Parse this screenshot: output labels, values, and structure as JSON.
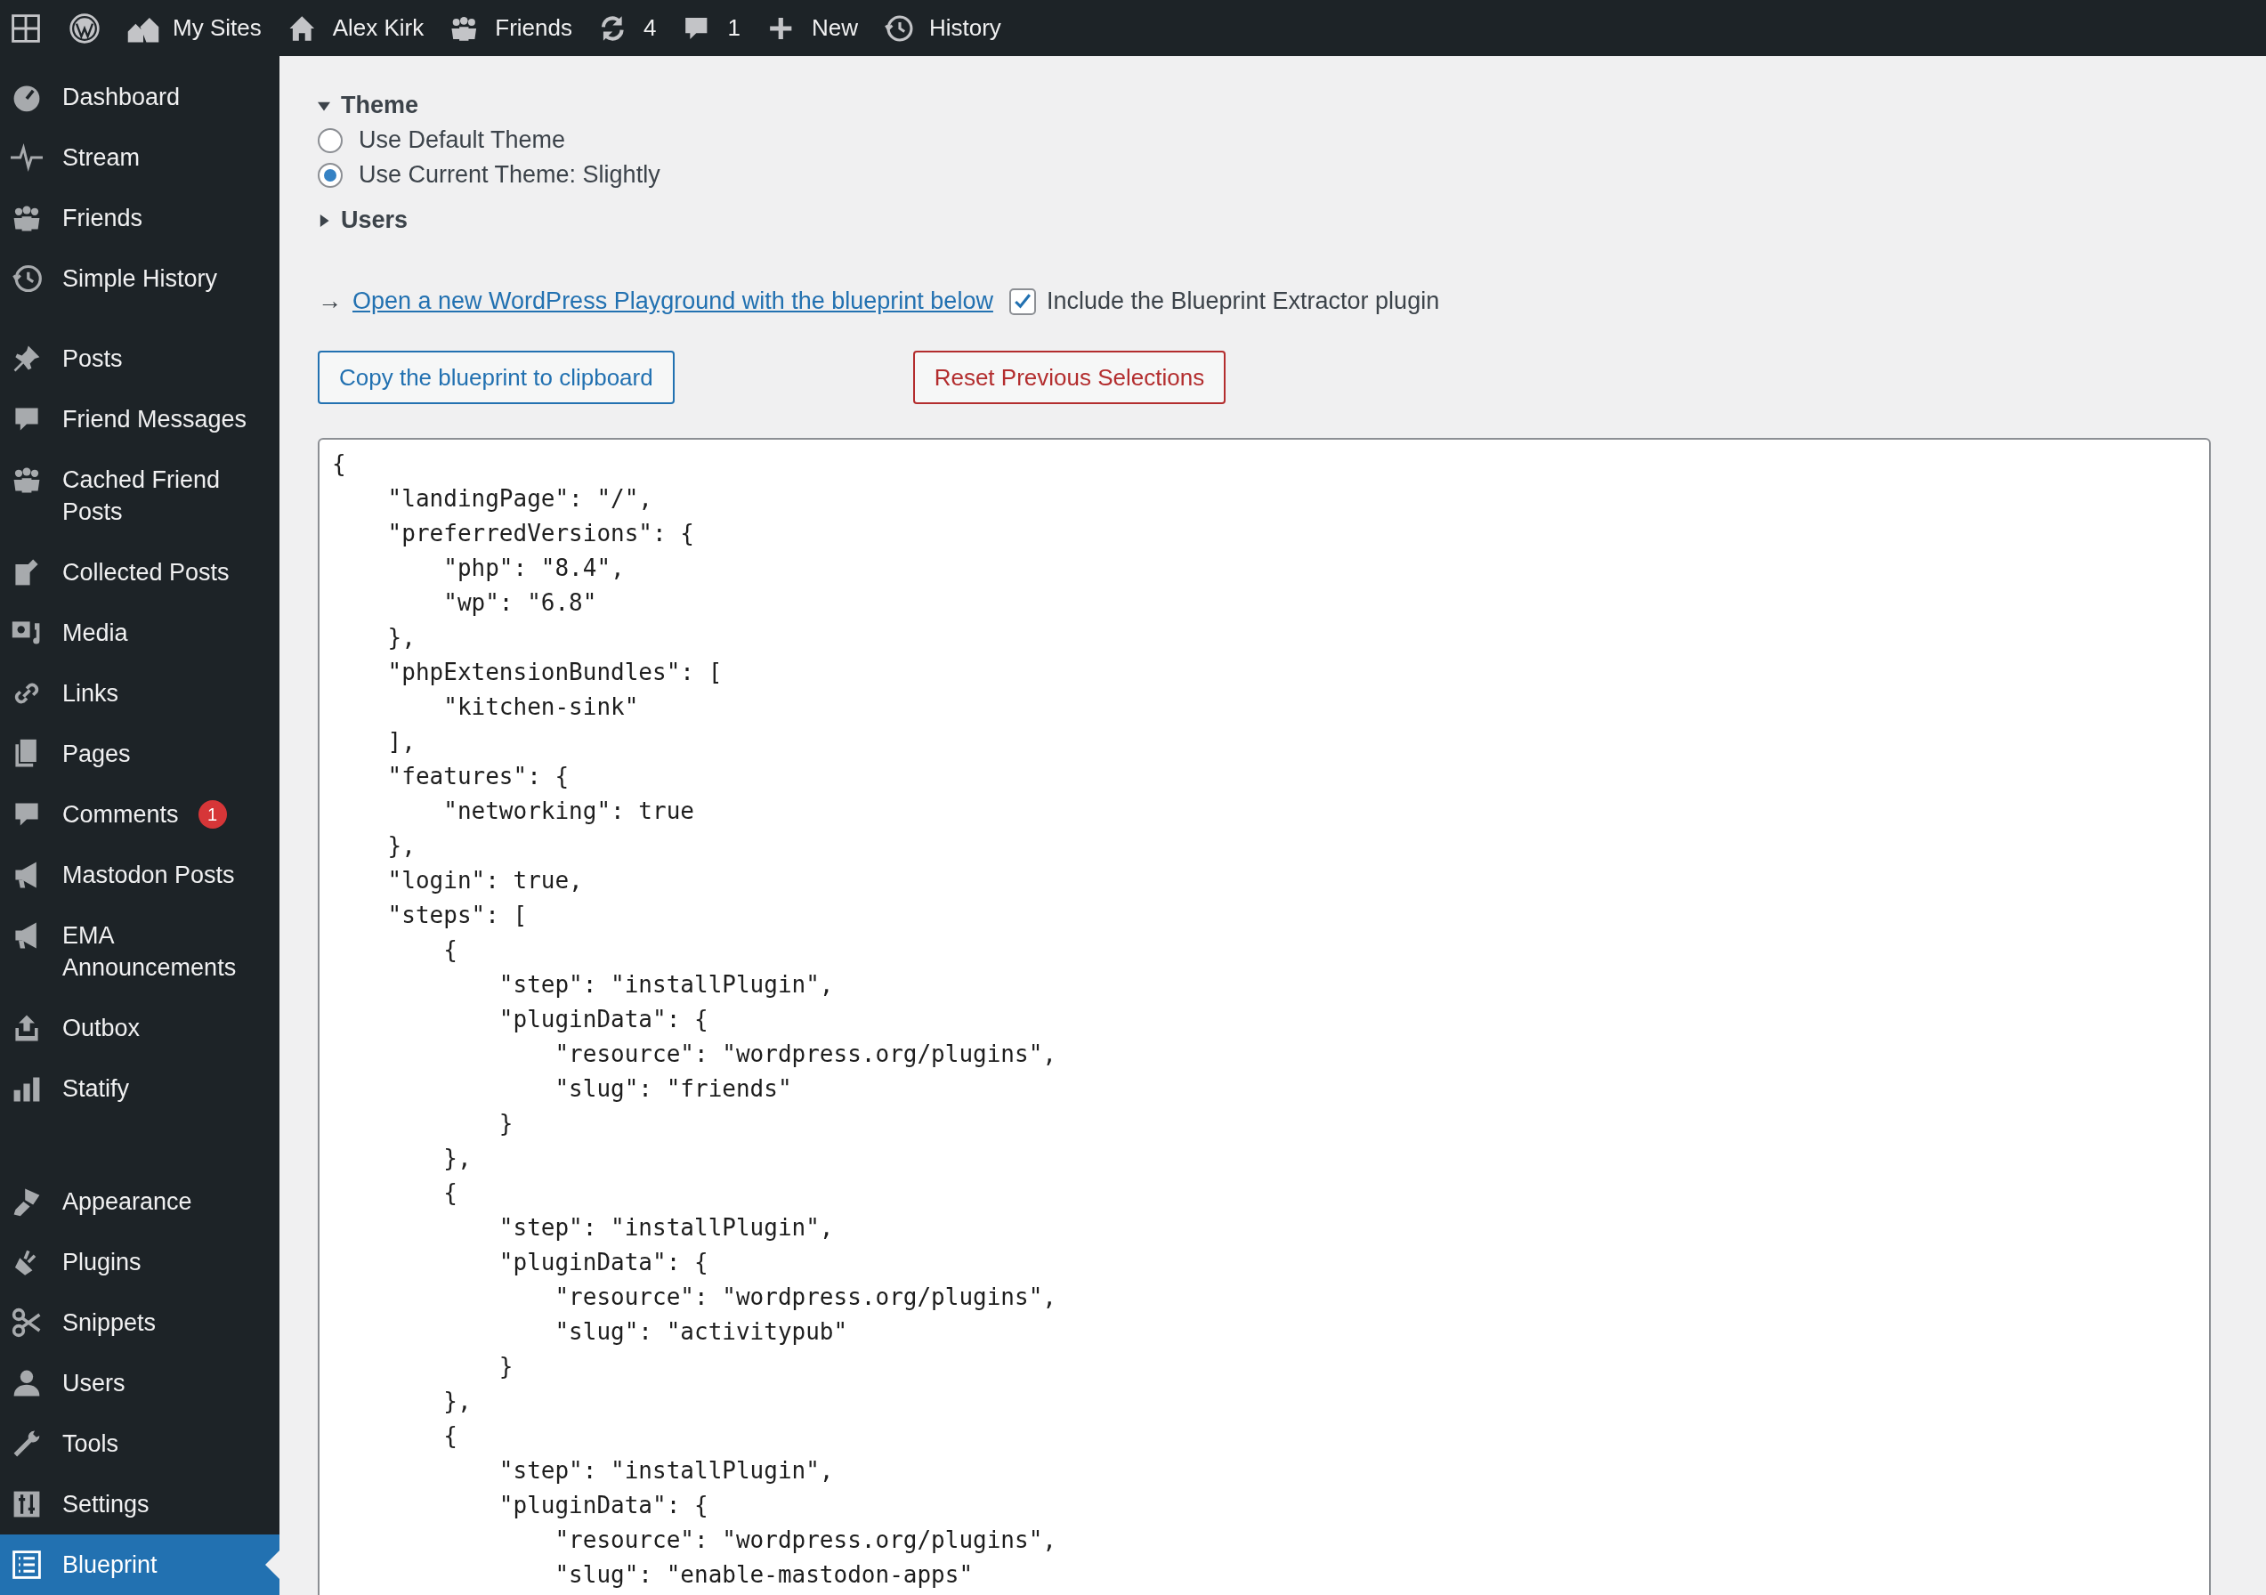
{
  "admin_bar": {
    "items": [
      {
        "label": "My Sites"
      },
      {
        "label": "Alex Kirk"
      },
      {
        "label": "Friends"
      },
      {
        "label": "4"
      },
      {
        "label": "1"
      },
      {
        "label": "New"
      },
      {
        "label": "History"
      }
    ]
  },
  "sidebar": {
    "groups": [
      {
        "items": [
          {
            "label": "Dashboard",
            "selected": false
          },
          {
            "label": "Stream",
            "selected": false
          },
          {
            "label": "Friends",
            "selected": false
          },
          {
            "label": "Simple History",
            "selected": false
          }
        ]
      },
      {
        "items": [
          {
            "label": "Posts",
            "selected": false
          },
          {
            "label": "Friend Messages",
            "selected": false
          },
          {
            "label": "Cached Friend Posts",
            "selected": false
          },
          {
            "label": "Collected Posts",
            "selected": false
          },
          {
            "label": "Media",
            "selected": false
          },
          {
            "label": "Links",
            "selected": false
          },
          {
            "label": "Pages",
            "selected": false
          },
          {
            "label": "Comments",
            "selected": false,
            "badge": "1"
          },
          {
            "label": "Mastodon Posts",
            "selected": false
          },
          {
            "label": "EMA Announcements",
            "selected": false
          },
          {
            "label": "Outbox",
            "selected": false
          },
          {
            "label": "Statify",
            "selected": false
          }
        ]
      },
      {
        "items": [
          {
            "label": "Appearance",
            "selected": false
          },
          {
            "label": "Plugins",
            "selected": false
          },
          {
            "label": "Snippets",
            "selected": false
          },
          {
            "label": "Users",
            "selected": false
          },
          {
            "label": "Tools",
            "selected": false
          },
          {
            "label": "Settings",
            "selected": false
          },
          {
            "label": "Blueprint",
            "selected": true
          }
        ]
      }
    ]
  },
  "sections": [
    {
      "title": "Theme",
      "expanded": true,
      "options": [
        {
          "label": "Use Default Theme",
          "selected": false
        },
        {
          "label": "Use Current Theme: Slightly",
          "selected": true
        }
      ]
    },
    {
      "title": "Users",
      "expanded": false
    }
  ],
  "playground_link": {
    "arrow": "→",
    "text": "Open a new WordPress Playground with the blueprint below",
    "checkbox": {
      "label": "Include the Blueprint Extractor plugin",
      "checked": true
    }
  },
  "buttons": [
    {
      "label": "Copy the blueprint to clipboard",
      "kind": "primary"
    },
    {
      "label": "Reset Previous Selections",
      "kind": "danger"
    }
  ],
  "blueprint_code": [
    "{",
    "    \"landingPage\": \"/\",",
    "    \"preferredVersions\": {",
    "        \"php\": \"8.4\",",
    "        \"wp\": \"6.8\"",
    "    },",
    "    \"phpExtensionBundles\": [",
    "        \"kitchen-sink\"",
    "    ],",
    "    \"features\": {",
    "        \"networking\": true",
    "    },",
    "    \"login\": true,",
    "    \"steps\": [",
    "        {",
    "            \"step\": \"installPlugin\",",
    "            \"pluginData\": {",
    "                \"resource\": \"wordpress.org/plugins\",",
    "                \"slug\": \"friends\"",
    "            }",
    "        },",
    "        {",
    "            \"step\": \"installPlugin\",",
    "            \"pluginData\": {",
    "                \"resource\": \"wordpress.org/plugins\",",
    "                \"slug\": \"activitypub\"",
    "            }",
    "        },",
    "        {",
    "            \"step\": \"installPlugin\",",
    "            \"pluginData\": {",
    "                \"resource\": \"wordpress.org/plugins\",",
    "                \"slug\": \"enable-mastodon-apps\""
  ]
}
